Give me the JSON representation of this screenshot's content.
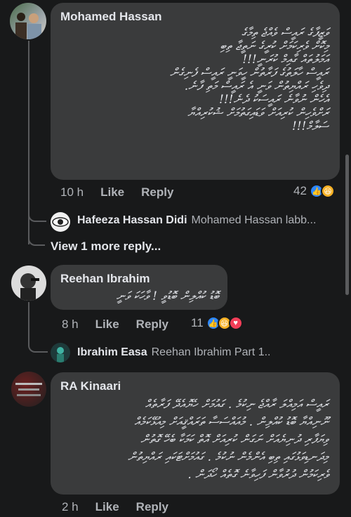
{
  "comments": [
    {
      "author": "Mohamed Hassan",
      "text": "ވަޒީފާގެ ރައީސް ވެއްޖެ ތިމާގެ\nމިކޮށް ވެރިކަމަށް ކުރީގެ ނަތީޖާ ތިބި\nއަމަލުތައް ގާއިމް ކުރަނީ!!!\nރައީސް ހާލަތުގެ ފަރާތުން ހީވަނީ ރައީސް ފެނިގެން\nދިވެހި ރައްޔިތުން ވަނީ އެ ރައީސް މަތި ފާނެ.\nއެހެން ނުވާނެ ރައީސަކު ދެނެ!!!\nރަށްވެހިން ކުރިއަށް ވަޑައިގަތުމަށް ޝުކުރިއްޔާ\nސަލާމް!!!",
      "time": "10 h",
      "like_label": "Like",
      "reply_label": "Reply",
      "reaction_count": "42"
    },
    {
      "author": "Reehan Ibrahim",
      "text": "ބޮޑު ކުއްލިން ބޮޑުވީ ! ވާހަކަ ވަނީ",
      "time": "8 h",
      "like_label": "Like",
      "reply_label": "Reply",
      "reaction_count": "11"
    },
    {
      "author": "RA Kinaari",
      "text": "ރައީސް އަމިއްލަ ރާއްޖެ ނިކުމެ . ގައުމަށް ހެޔޮއެދޭ ފަރާތެއް\nނޫނިއްޔާ ބޮޑު ކުއްލިން . މުއައްސަސާ ތަރައްޤީއަށް މިއުޅޭކަމެއް\nވިޔަފާރި ދުނިޔެއަށް ނަގަން ކުރިއަށް އޮތް ކަމަކާ ބެހޭ ގޮތުން\nމިދަނޑިވަޅުގައި ތިބި އެންމެން ނުކުމެ . ގައުމަށްޓަކައި ރައްޔިތުން\nވެރިކަމުން ދުރުވާން ފަހިވާނެ ގޮތެއް ހޯދަން .",
      "time": "2 h",
      "like_label": "Like",
      "reply_label": "Reply"
    }
  ],
  "replies": [
    {
      "author": "Hafeeza Hassan Didi",
      "preview": "Mohamed Hassan labb..."
    },
    {
      "author": "Ibrahim Easa",
      "preview": "Reehan Ibrahim Part 1.."
    }
  ],
  "view_more_label": "View 1 more reply...",
  "reactions": {
    "first": [
      "like-icon",
      "haha-icon"
    ],
    "second": [
      "like-icon",
      "haha-icon",
      "love-icon"
    ]
  },
  "colors": {
    "background": "#18191a",
    "bubble": "#3a3b3c",
    "like": "#2d88ff",
    "haha": "#f7b125",
    "love": "#f33e58"
  }
}
